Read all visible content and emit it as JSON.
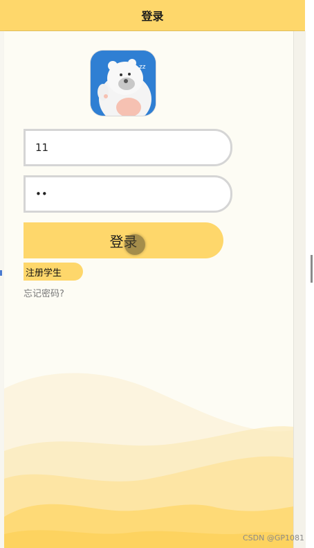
{
  "header": {
    "title": "登录"
  },
  "form": {
    "username_value": "11",
    "password_value": "••",
    "login_label": "登录",
    "register_label": "注册学生",
    "forgot_label": "忘记密码?"
  },
  "colors": {
    "accent": "#fed76b",
    "page_bg": "#fdfcf4"
  },
  "watermark": "CSDN @GP1081"
}
